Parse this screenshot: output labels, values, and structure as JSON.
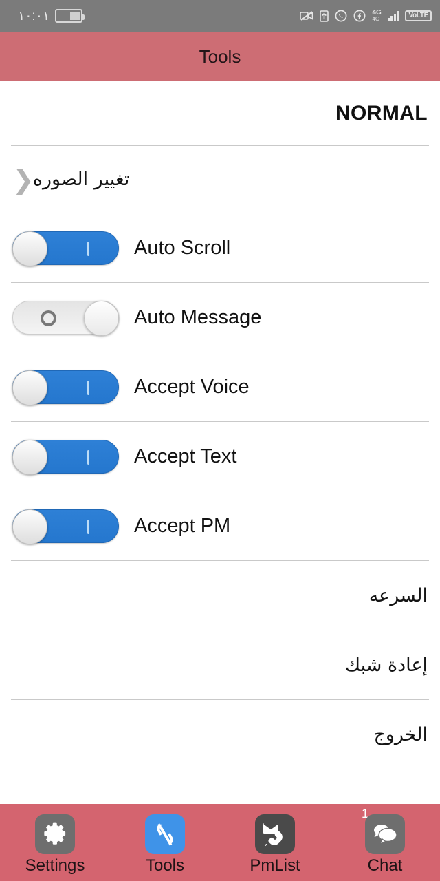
{
  "statusbar": {
    "time": "١٠:٠١",
    "battery_icon": "battery-half-icon",
    "right_icons": [
      {
        "name": "camera-muted-icon"
      },
      {
        "name": "screenshot-upload-icon"
      },
      {
        "name": "whatsapp-icon"
      },
      {
        "name": "facebook-circle-icon"
      },
      {
        "name": "signal-4g-icon",
        "label_top": "4G",
        "label_bottom": "4G"
      },
      {
        "name": "volte-badge-icon",
        "label": "VoLTE"
      }
    ]
  },
  "titlebar": {
    "title": "Tools",
    "bg_color": "#cd6d74"
  },
  "content": {
    "mode_label": "NORMAL",
    "change_picture": {
      "label": "تغيير الصوره",
      "chevron": "chevron-right-icon"
    },
    "toggles": [
      {
        "label": "Auto Scroll",
        "state": "on"
      },
      {
        "label": "Auto Message",
        "state": "off"
      },
      {
        "label": "Accept Voice",
        "state": "on"
      },
      {
        "label": "Accept Text",
        "state": "on"
      },
      {
        "label": "Accept PM",
        "state": "on"
      }
    ],
    "actions": [
      {
        "label": "السرعه"
      },
      {
        "label": "إعادة شبك"
      },
      {
        "label": "الخروج"
      }
    ],
    "toggle_on_color": "#2e80d6",
    "toggle_off_color": "#e9e9e9"
  },
  "navbar": {
    "bg_color": "#d4646f",
    "items": [
      {
        "label": "Settings",
        "icon": "gear-icon",
        "tile": "gray",
        "active": false,
        "badge": ""
      },
      {
        "label": "Tools",
        "icon": "wrench-icon",
        "tile": "blue",
        "active": true,
        "badge": ""
      },
      {
        "label": "PmList",
        "icon": "envelope-phone-icon",
        "tile": "dark",
        "active": false,
        "badge": ""
      },
      {
        "label": "Chat",
        "icon": "speech-bubbles-icon",
        "tile": "gray",
        "active": false,
        "badge": "1"
      }
    ]
  }
}
